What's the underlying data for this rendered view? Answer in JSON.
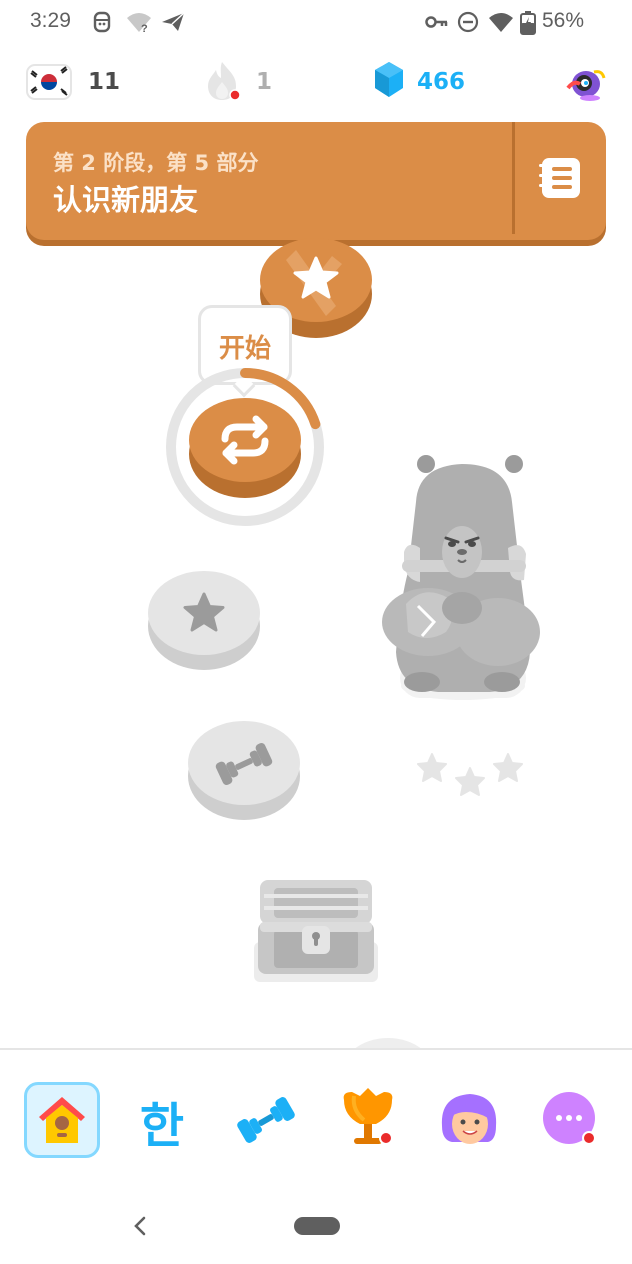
{
  "status_bar": {
    "time": "3:29",
    "battery_percent": "56%",
    "battery_level": 0.56
  },
  "top_bar": {
    "course_flag_icon": "korea-flag-icon",
    "streak_count": "11",
    "hearts_or_fire_count": "1",
    "gems_count": "466",
    "colors": {
      "gems": "#1cb0f6",
      "streak_text": "#4b4b4b",
      "inactive": "#afafaf"
    }
  },
  "unit_banner": {
    "subtitle": "第 2 阶段，第 5 部分",
    "title": "认识新朋友",
    "color": "#db8d47"
  },
  "path": {
    "start_tooltip": "开始",
    "nodes": [
      {
        "icon": "star-icon",
        "state": "completed"
      },
      {
        "icon": "practice-loop-icon",
        "state": "current",
        "progress": 0.2
      },
      {
        "icon": "star-icon",
        "state": "locked"
      },
      {
        "icon": "dumbbell-icon",
        "state": "locked"
      },
      {
        "icon": "treasure-chest-icon",
        "state": "locked"
      }
    ],
    "character": "bear-character",
    "stars_earned": 0,
    "stars_total": 3
  },
  "bottom_nav": {
    "items": [
      {
        "name": "home",
        "icon": "birdhouse-icon",
        "active": true
      },
      {
        "name": "characters",
        "icon": "hangul-icon",
        "label": "한",
        "active": false
      },
      {
        "name": "practice",
        "icon": "dumbbell-icon",
        "active": false
      },
      {
        "name": "leaderboards",
        "icon": "trophy-icon",
        "active": false
      },
      {
        "name": "profile",
        "icon": "avatar-icon",
        "active": false
      },
      {
        "name": "more",
        "icon": "more-icon",
        "active": false
      }
    ]
  }
}
